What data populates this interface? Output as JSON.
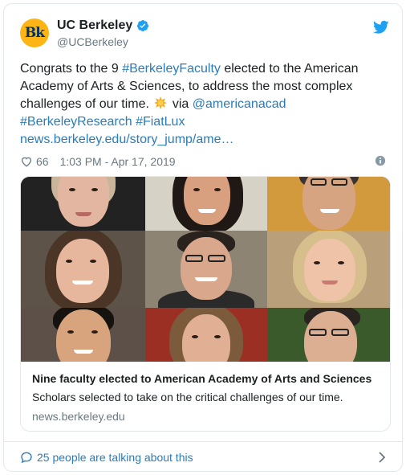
{
  "account": {
    "display_name": "UC Berkeley",
    "handle": "@UCBerkeley",
    "avatar_text": "Bk",
    "verified": true
  },
  "tweet": {
    "segments": [
      {
        "text": "Congrats to the 9 ",
        "link": false
      },
      {
        "text": "#BerkeleyFaculty",
        "link": true
      },
      {
        "text": " elected to the American Academy of Arts & Sciences,  to address the most complex challenges of our time. ",
        "link": false
      },
      {
        "emoji": "sun-emoji"
      },
      {
        "text": " via ",
        "link": false
      },
      {
        "text": "@americanacad",
        "link": true
      },
      {
        "text": " ",
        "link": false
      },
      {
        "text": "#BerkeleyResearch",
        "link": true
      },
      {
        "text": " ",
        "link": false
      },
      {
        "text": "#FiatLux",
        "link": true
      },
      {
        "text": " ",
        "link": false
      },
      {
        "text": "news.berkeley.edu/story_jump/ame…",
        "link": true
      }
    ]
  },
  "meta": {
    "like_count": "66",
    "timestamp": "1:03 PM - Apr 17, 2019"
  },
  "card": {
    "title": "Nine faculty elected to American Academy of Arts and Sciences",
    "description": "Scholars selected to take on the critical challenges of our time.",
    "domain": "news.berkeley.edu"
  },
  "footer": {
    "talking_text": "25 people are talking about this"
  },
  "colors": {
    "link": "#2b7bb9",
    "secondary_text": "#697882",
    "border": "#e1e8ed",
    "verified": "#1da1f2",
    "avatar_bg": "#fdb515",
    "avatar_fg": "#003262"
  }
}
